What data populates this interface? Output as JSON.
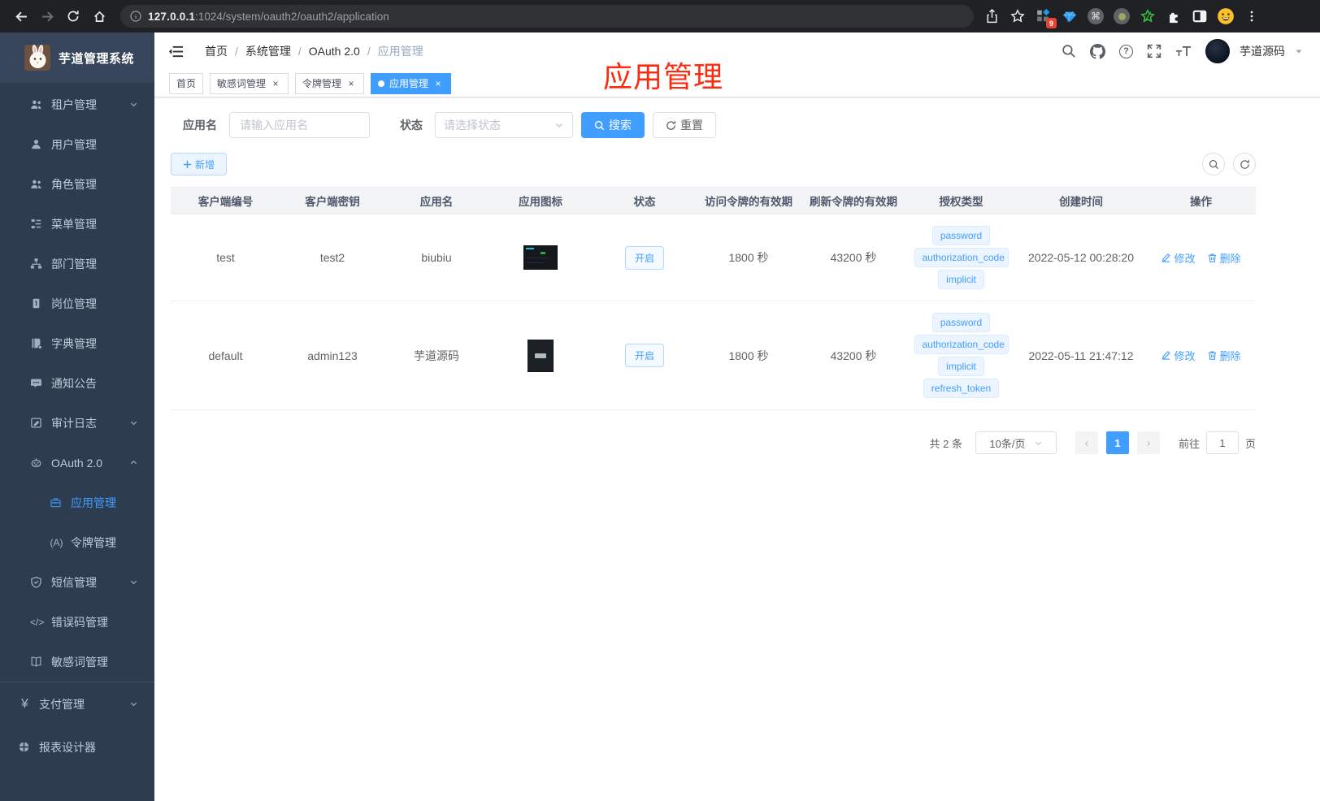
{
  "browser": {
    "url": {
      "host": "127.0.0.1",
      "path": ":1024/system/oauth2/oauth2/application"
    },
    "extensions_badge": "9"
  },
  "icons": {
    "question_mark": "?",
    "close": "×",
    "command": "⌘",
    "signal": "(A)",
    "code": "</>",
    "yen": "¥",
    "prev_arrow": "‹",
    "next_arrow": "›"
  },
  "sidebar": {
    "title": "芋道管理系统",
    "items": [
      {
        "label": "租户管理"
      },
      {
        "label": "用户管理"
      },
      {
        "label": "角色管理"
      },
      {
        "label": "菜单管理"
      },
      {
        "label": "部门管理"
      },
      {
        "label": "岗位管理"
      },
      {
        "label": "字典管理"
      },
      {
        "label": "通知公告"
      },
      {
        "label": "审计日志"
      },
      {
        "label": "OAuth 2.0"
      },
      {
        "label": "应用管理"
      },
      {
        "label": "令牌管理"
      },
      {
        "label": "短信管理"
      },
      {
        "label": "错误码管理"
      },
      {
        "label": "敏感词管理"
      },
      {
        "label": "支付管理"
      },
      {
        "label": "报表设计器"
      }
    ]
  },
  "navbar": {
    "separator": "/",
    "breadcrumbs": [
      "首页",
      "系统管理",
      "OAuth 2.0",
      "应用管理"
    ],
    "username": "芋道源码"
  },
  "tabs": [
    {
      "label": "首页"
    },
    {
      "label": "敏感词管理"
    },
    {
      "label": "令牌管理"
    },
    {
      "label": "应用管理"
    }
  ],
  "annotation": {
    "text": "应用管理"
  },
  "filters": {
    "name_label": "应用名",
    "name_placeholder": "请输入应用名",
    "status_label": "状态",
    "status_placeholder": "请选择状态",
    "search_label": "搜索",
    "reset_label": "重置"
  },
  "toolbar": {
    "add_label": "新增"
  },
  "table": {
    "headers": [
      "客户端编号",
      "客户端密钥",
      "应用名",
      "应用图标",
      "状态",
      "访问令牌的有效期",
      "刷新令牌的有效期",
      "授权类型",
      "创建时间",
      "操作"
    ],
    "labels": {
      "edit": "修改",
      "delete": "删除"
    },
    "rows": [
      {
        "client_id": "test",
        "client_secret": "test2",
        "app_name": "biubiu",
        "status": "开启",
        "access_ttl": "1800 秒",
        "refresh_ttl": "43200 秒",
        "grant_types": [
          "password",
          "authorization_code",
          "implicit"
        ],
        "created_at": "2022-05-12 00:28:20"
      },
      {
        "client_id": "default",
        "client_secret": "admin123",
        "app_name": "芋道源码",
        "status": "开启",
        "access_ttl": "1800 秒",
        "refresh_ttl": "43200 秒",
        "grant_types": [
          "password",
          "authorization_code",
          "implicit",
          "refresh_token"
        ],
        "created_at": "2022-05-11 21:47:12"
      }
    ]
  },
  "pagination": {
    "total": "共 2 条",
    "page_size": "10条/页",
    "current_page": "1",
    "goto_label": "前往",
    "goto_value": "1",
    "unit": "页"
  },
  "colors": {
    "accent": "#409eff",
    "annotation_red": "#fc2b10",
    "sidebar_bg": "#2e3c50",
    "tag_bg": "#ecf5ff"
  }
}
